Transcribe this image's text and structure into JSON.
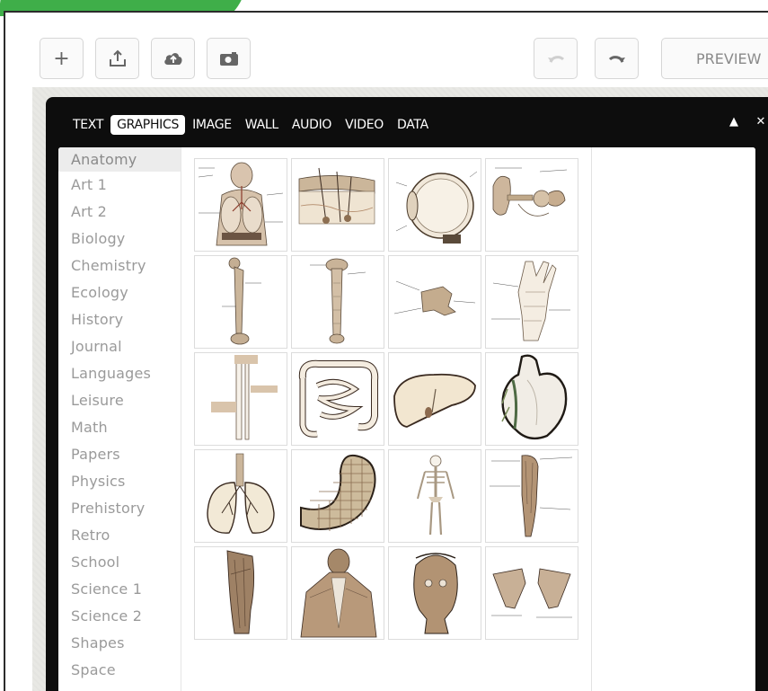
{
  "toolbar": {
    "preview_label": "PREVIEW"
  },
  "tabs": [
    {
      "label": "TEXT"
    },
    {
      "label": "GRAPHICS"
    },
    {
      "label": "IMAGE"
    },
    {
      "label": "WALL"
    },
    {
      "label": "AUDIO"
    },
    {
      "label": "VIDEO"
    },
    {
      "label": "DATA"
    }
  ],
  "panel_controls": {
    "collapse": "▲",
    "close": "✕"
  },
  "categories": [
    {
      "label": "Anatomy"
    },
    {
      "label": "Art 1"
    },
    {
      "label": "Art 2"
    },
    {
      "label": "Biology"
    },
    {
      "label": "Chemistry"
    },
    {
      "label": "Ecology"
    },
    {
      "label": "History"
    },
    {
      "label": "Journal"
    },
    {
      "label": "Languages"
    },
    {
      "label": "Leisure"
    },
    {
      "label": "Math"
    },
    {
      "label": "Papers"
    },
    {
      "label": "Physics"
    },
    {
      "label": "Prehistory"
    },
    {
      "label": "Retro"
    },
    {
      "label": "School"
    },
    {
      "label": "Science 1"
    },
    {
      "label": "Science 2"
    },
    {
      "label": "Shapes"
    },
    {
      "label": "Space"
    }
  ],
  "selected_category": "Anatomy",
  "colors": {
    "panel_bg": "#0d0d0d",
    "tab_active_bg": "#ffffff",
    "category_text": "#9a9a9a",
    "brand_green": "#3fae49",
    "sketch_tan": "#c9b9a1"
  },
  "graphics": [
    {
      "icon": "respiratory-system-icon"
    },
    {
      "icon": "skin-cross-section-icon"
    },
    {
      "icon": "eye-cross-section-icon"
    },
    {
      "icon": "ear-cross-section-icon"
    },
    {
      "icon": "femur-bone-icon"
    },
    {
      "icon": "tibia-bone-icon"
    },
    {
      "icon": "vertebra-icon"
    },
    {
      "icon": "foot-bones-icon"
    },
    {
      "icon": "leg-bones-icon"
    },
    {
      "icon": "intestines-icon"
    },
    {
      "icon": "liver-icon"
    },
    {
      "icon": "heart-icon"
    },
    {
      "icon": "lungs-icon"
    },
    {
      "icon": "stomach-icon"
    },
    {
      "icon": "skeleton-icon"
    },
    {
      "icon": "leg-muscles-icon"
    },
    {
      "icon": "forearm-muscles-icon"
    },
    {
      "icon": "back-muscles-icon"
    },
    {
      "icon": "head-muscles-icon"
    },
    {
      "icon": "shoulder-blades-icon"
    }
  ]
}
